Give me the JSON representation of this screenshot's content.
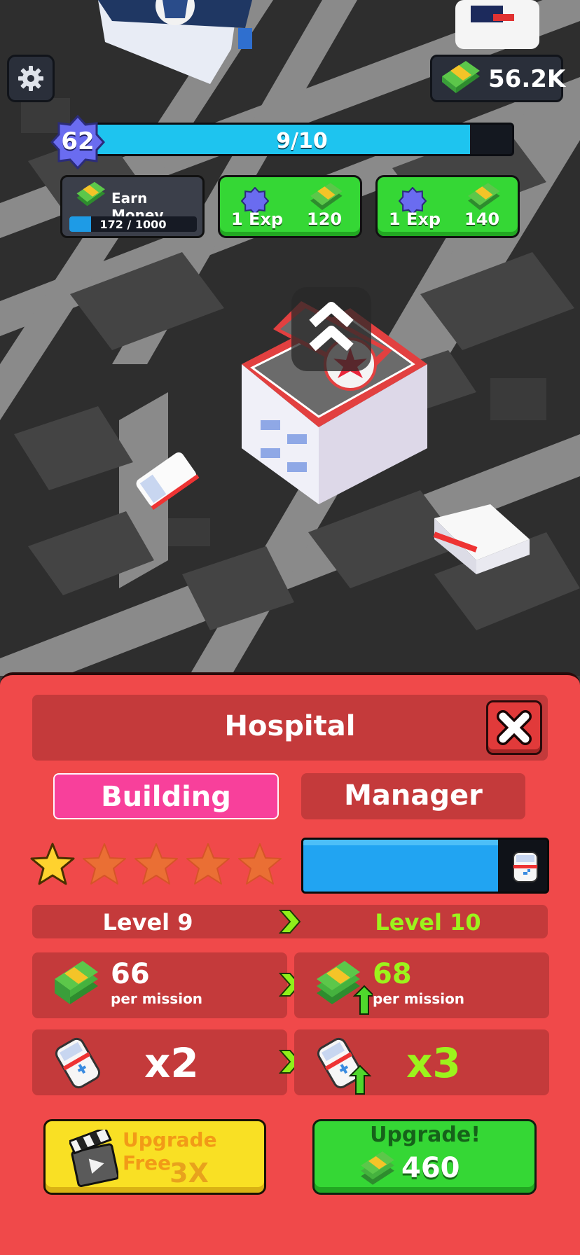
{
  "hud": {
    "money": "56.2K",
    "player_level": "62",
    "xp_text": "9/10",
    "xp_fraction": 0.9,
    "earn_money": {
      "label": "Earn Money",
      "progress_text": "172 / 1000",
      "progress_fraction": 0.172
    },
    "rewards": [
      {
        "exp": "1 Exp",
        "cash": "120"
      },
      {
        "exp": "1 Exp",
        "cash": "140"
      }
    ]
  },
  "panel": {
    "title": "Hospital",
    "tabs": {
      "building": "Building",
      "manager": "Manager"
    },
    "stars": {
      "filled": 1,
      "total": 5
    },
    "manager_progress_fraction": 0.8,
    "level_current": "Level 9",
    "level_next": "Level 10",
    "income_current": "66",
    "income_next": "68",
    "income_unit": "per mission",
    "vehicles_current": "x2",
    "vehicles_next": "x3",
    "upgrade_free": {
      "label": "Upgrade Free",
      "count": "3X"
    },
    "upgrade": {
      "label": "Upgrade!",
      "price": "460"
    }
  },
  "colors": {
    "panel": "#f0494a",
    "panel_dark": "#c43a3b",
    "green_text": "#9cf31c",
    "tab_active": "#f8409b",
    "button_green": "#35d735",
    "button_yellow": "#f9e024",
    "xp_fill": "#1ec4ef"
  },
  "icons": [
    "gear-icon",
    "cash-stack-icon",
    "star-badge-icon",
    "upgrade-chevron-icon",
    "close-icon",
    "star-icon",
    "ambulance-icon",
    "arrow-right-icon",
    "clapperboard-icon"
  ]
}
